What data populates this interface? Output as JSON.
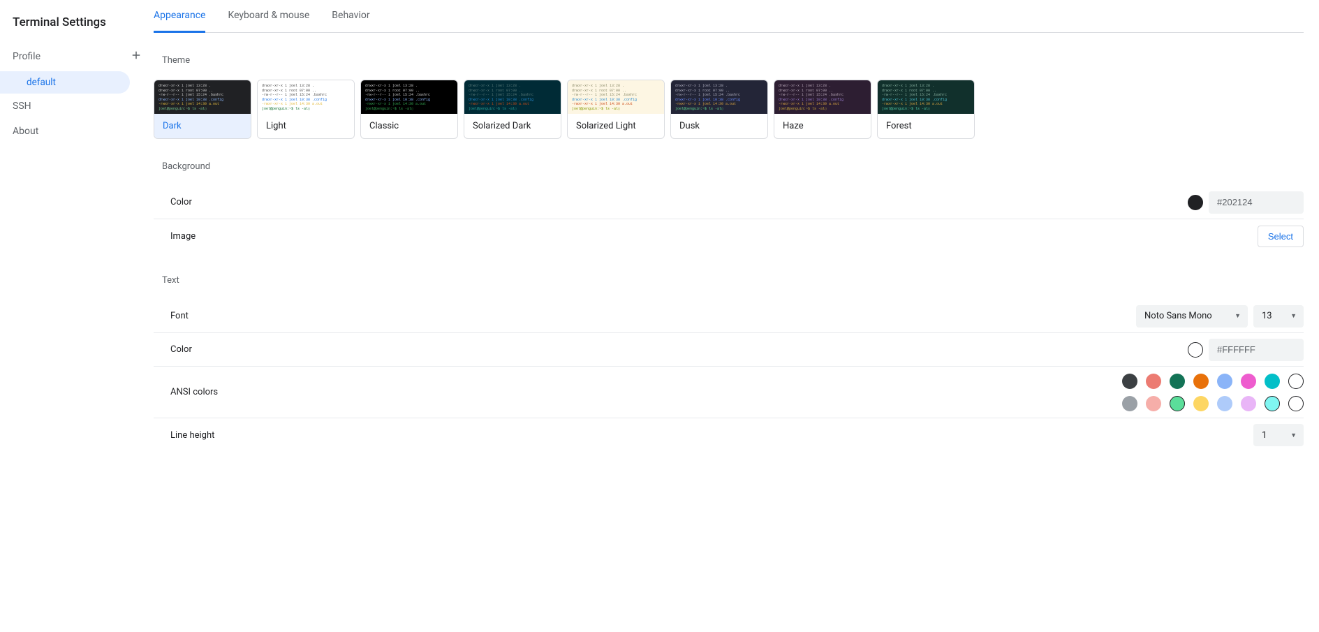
{
  "app_title": "Terminal Settings",
  "sidebar": {
    "profile_label": "Profile",
    "profile_sub": "default",
    "ssh_label": "SSH",
    "about_label": "About"
  },
  "tabs": {
    "appearance": "Appearance",
    "keyboard": "Keyboard & mouse",
    "behavior": "Behavior"
  },
  "sections": {
    "theme": "Theme",
    "background": "Background",
    "text": "Text"
  },
  "themes": [
    {
      "id": "dark",
      "label": "Dark",
      "preview_class": "prev-dark",
      "selected": true
    },
    {
      "id": "light",
      "label": "Light",
      "preview_class": "prev-light",
      "selected": false
    },
    {
      "id": "classic",
      "label": "Classic",
      "preview_class": "prev-classic",
      "selected": false
    },
    {
      "id": "solarized-dark",
      "label": "Solarized Dark",
      "preview_class": "prev-soldark",
      "selected": false
    },
    {
      "id": "solarized-light",
      "label": "Solarized Light",
      "preview_class": "prev-sollig",
      "selected": false
    },
    {
      "id": "dusk",
      "label": "Dusk",
      "preview_class": "prev-dusk",
      "selected": false
    },
    {
      "id": "haze",
      "label": "Haze",
      "preview_class": "prev-haze",
      "selected": false
    },
    {
      "id": "forest",
      "label": "Forest",
      "preview_class": "prev-forest",
      "selected": false
    }
  ],
  "theme_preview_lines": [
    {
      "text": "drwxr-xr-x 1 joel 13:28 .",
      "cls": ""
    },
    {
      "text": "drwxr-xr-x 1 root 07:00 ..",
      "cls": ""
    },
    {
      "text": "-rw-r--r-- 1 joel 15:24 .bashrc",
      "cls": ""
    },
    {
      "text": "drwxr-xr-x 1 joel 10:38 .config",
      "cls": "ln-dir"
    },
    {
      "text": "-rwxr-xr-x 1 joel 14:30 a.out",
      "cls": "ln-exec"
    },
    {
      "text": "joel@penguin:~$ ls -al▯",
      "cls": "ln-prompt"
    }
  ],
  "background": {
    "color_label": "Color",
    "color_value": "#202124",
    "image_label": "Image",
    "select_button": "Select"
  },
  "text": {
    "font_label": "Font",
    "font_family": "Noto Sans Mono",
    "font_size": "13",
    "color_label": "Color",
    "color_value": "#FFFFFF",
    "ansi_label": "ANSI colors",
    "line_height_label": "Line height",
    "line_height_value": "1"
  },
  "ansi_colors": {
    "row1": [
      "#3c4043",
      "#ec7b72",
      "#137356",
      "#e8710a",
      "#8ab4f8",
      "#ee5cce",
      "#03bfc8",
      "#ffffff"
    ],
    "row2": [
      "#9aa0a6",
      "#f6aea9",
      "#5bde9a",
      "#fdd663",
      "#aecbfa",
      "#e9b5f7",
      "#80f6f2",
      "#ffffff"
    ],
    "outline_indices_row1": [
      7
    ],
    "outline_indices_row2": [
      2,
      6,
      7
    ]
  }
}
